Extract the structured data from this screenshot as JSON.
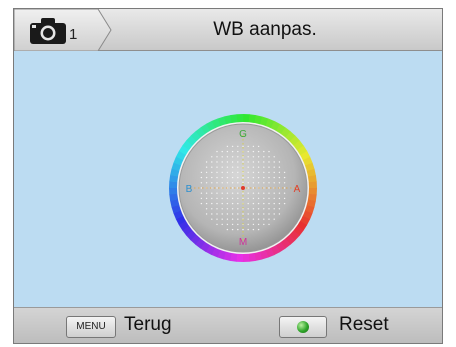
{
  "header": {
    "mode_number": "1",
    "title": "WB aanpas.",
    "mode_icon": "camera-icon"
  },
  "wheel": {
    "label_top": "G",
    "label_bottom": "M",
    "label_left": "B",
    "label_right": "A",
    "colors": {
      "label_g": "#3aa83a",
      "label_m": "#d0309a",
      "label_b": "#2a8fd0",
      "label_a": "#e0402a"
    }
  },
  "footer": {
    "menu_key": "MENU",
    "back_label": "Terug",
    "ok_icon": "ok-button-icon",
    "reset_label": "Reset"
  },
  "colors": {
    "background": "#bcdcf2",
    "header": "#d9d9d9",
    "footer": "#c8c8c8"
  }
}
